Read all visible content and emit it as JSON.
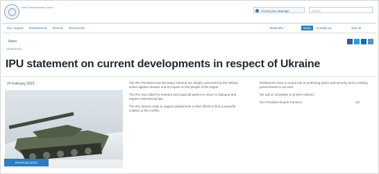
{
  "header": {
    "org_name": "Inter-Parliamentary Union",
    "language_select": "Choose your language",
    "search_placeholder": "Search"
  },
  "nav": {
    "left_items": [
      "Our impact",
      "Parliaments",
      "Events",
      "Resources"
    ],
    "right_items": [
      "About IPU",
      "News",
      "Contact us",
      "Join us"
    ],
    "active_item": "News"
  },
  "breadcrumb": {
    "home": "News",
    "current": "Statements"
  },
  "share": {
    "icons": [
      "facebook-icon",
      "twitter-icon",
      "linkedin-icon",
      "email-icon"
    ]
  },
  "article": {
    "title": "IPU statement on current developments in respect of Ukraine",
    "date": "24 February 2022",
    "photo_button": "Download photo",
    "col_a": [
      "The IPU President and Secretary General are deeply concerned by the military action against Ukraine and its impact on the people of the region.",
      "The IPU has called for restraint and urged all parties to return to dialogue and respect international law.",
      "The IPU stands ready to support parliaments in their efforts to find a peaceful solution to the conflict."
    ],
    "col_b": [
      "Parliaments have a crucial role in protecting peace and security and in holding governments to account.",
      "We call on all parties to protect civilians.",
      "IPU President Duarte Pacheco"
    ],
    "col_b_number": "1/2"
  }
}
